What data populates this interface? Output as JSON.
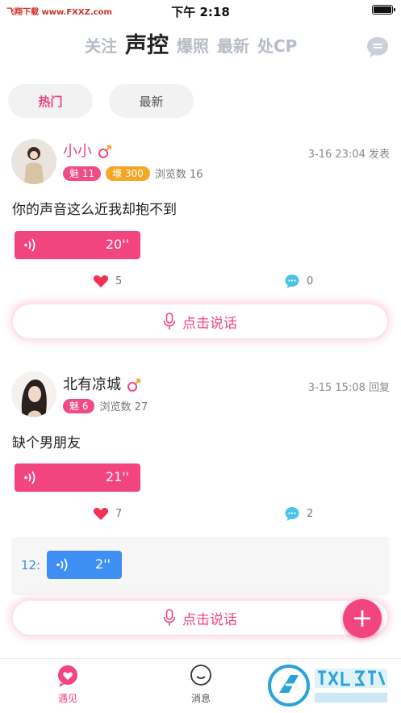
{
  "status_bar": {
    "left_text": "飞翔下载 www.FXXZ.com",
    "time": "下午 2:18"
  },
  "top_tabs": [
    {
      "label": "关注",
      "active": false
    },
    {
      "label": "声控",
      "active": true
    },
    {
      "label": "爆照",
      "active": false
    },
    {
      "label": "最新",
      "active": false
    },
    {
      "label": "处CP",
      "active": false
    }
  ],
  "filters": [
    {
      "label": "热门",
      "active": true
    },
    {
      "label": "最新",
      "active": false
    }
  ],
  "posts": [
    {
      "username": "小小",
      "username_color": "#f0427a",
      "badge_charm": "魅 11",
      "badge_wealth": "壕 300",
      "views": "浏览数 16",
      "meta": "3-16 23:04 发表",
      "text": "你的声音这么近我却抱不到",
      "voice_duration": "20''",
      "likes": "5",
      "comments": "0",
      "talk_label": "点击说话"
    },
    {
      "username": "北有凉城",
      "username_color": "#222222",
      "badge_charm": "魅 6",
      "views": "浏览数 27",
      "meta": "3-15 15:08 回复",
      "text": "缺个男朋友",
      "voice_duration": "21''",
      "likes": "7",
      "comments": "2",
      "comment_label": "12:",
      "comment_voice_duration": "2''",
      "talk_label": "点击说话"
    }
  ],
  "fab_label": "+",
  "bottom_nav": [
    {
      "label": "遇见",
      "icon": "heart-chat-icon",
      "active": true
    },
    {
      "label": "消息",
      "icon": "smile-chat-icon",
      "active": false
    }
  ],
  "watermark": {
    "brand": "飞翔下载",
    "url": "www.FXXZ.com"
  },
  "colors": {
    "accent": "#f2457f",
    "blue": "#3f8ef3",
    "gold": "#f5a623",
    "comment_teal": "#4cc3e8"
  }
}
